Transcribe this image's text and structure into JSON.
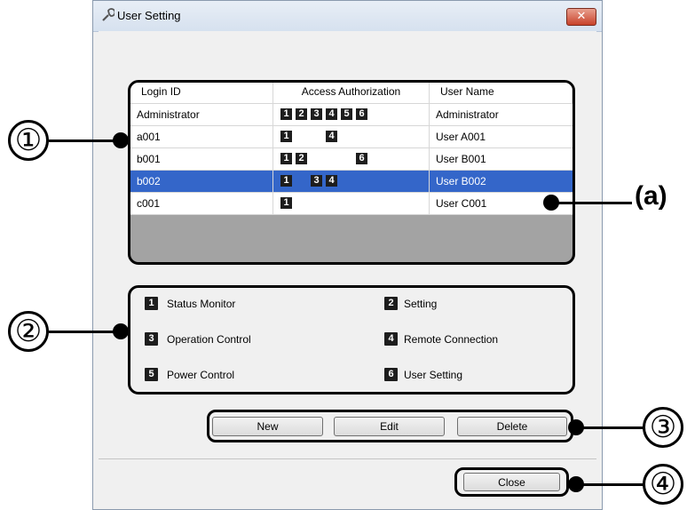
{
  "window": {
    "title": "User Setting",
    "close_glyph": "✕"
  },
  "grid": {
    "headers": [
      "Login ID",
      "Access Authorization",
      "User Name"
    ],
    "rows": [
      {
        "login": "Administrator",
        "access": [
          "1",
          "2",
          "3",
          "4",
          "5",
          "6"
        ],
        "user": "Administrator",
        "selected": false
      },
      {
        "login": "a001",
        "access": [
          "1",
          "4"
        ],
        "user": "User A001",
        "selected": false
      },
      {
        "login": "b001",
        "access": [
          "1",
          "2",
          "6"
        ],
        "user": "User B001",
        "selected": false
      },
      {
        "login": "b002",
        "access": [
          "1",
          "3",
          "4"
        ],
        "user": "User B002",
        "selected": true
      },
      {
        "login": "c001",
        "access": [
          "1"
        ],
        "user": "User C001",
        "selected": false
      }
    ]
  },
  "legend": [
    {
      "num": "1",
      "label": "Status Monitor"
    },
    {
      "num": "2",
      "label": "Setting"
    },
    {
      "num": "3",
      "label": "Operation Control"
    },
    {
      "num": "4",
      "label": "Remote Connection"
    },
    {
      "num": "5",
      "label": "Power Control"
    },
    {
      "num": "6",
      "label": "User Setting"
    }
  ],
  "buttons": {
    "new": "New",
    "edit": "Edit",
    "delete": "Delete",
    "close": "Close"
  },
  "callouts": {
    "c1": "①",
    "c2": "②",
    "c3": "③",
    "c4": "④",
    "a": "(a)"
  },
  "colors": {
    "selected_row": "#3466c9",
    "badge": "#1d1d1d",
    "grid_empty": "#a3a3a3"
  }
}
